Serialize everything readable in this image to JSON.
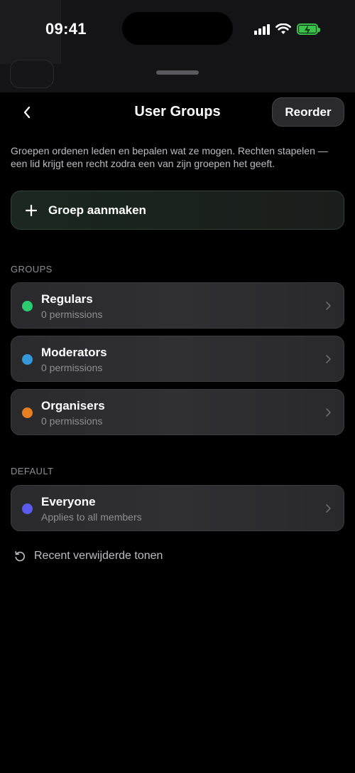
{
  "status_bar": {
    "time": "09:41"
  },
  "nav": {
    "title": "User Groups",
    "reorder_label": "Reorder"
  },
  "description": "Groepen ordenen leden en bepalen wat ze mogen. Rechten stapelen — een lid krijgt een recht zodra een van zijn groepen het geeft.",
  "create_button": {
    "label": "Groep aanmaken",
    "icon": "plus-icon"
  },
  "sections": {
    "groups_label": "GROUPS",
    "default_label": "DEFAULT"
  },
  "groups": [
    {
      "name": "Regulars",
      "subtitle": "0 permissions",
      "color": "#2ecc71"
    },
    {
      "name": "Moderators",
      "subtitle": "0 permissions",
      "color": "#3498db"
    },
    {
      "name": "Organisers",
      "subtitle": "0 permissions",
      "color": "#e67e22"
    }
  ],
  "default_group": {
    "name": "Everyone",
    "subtitle": "Applies to all members",
    "color": "#5b5bf0"
  },
  "restore_link": {
    "label": "Recent verwijderde tonen",
    "icon": "restore-icon"
  },
  "colors": {
    "battery": "#38c24a",
    "background": "#000000"
  }
}
